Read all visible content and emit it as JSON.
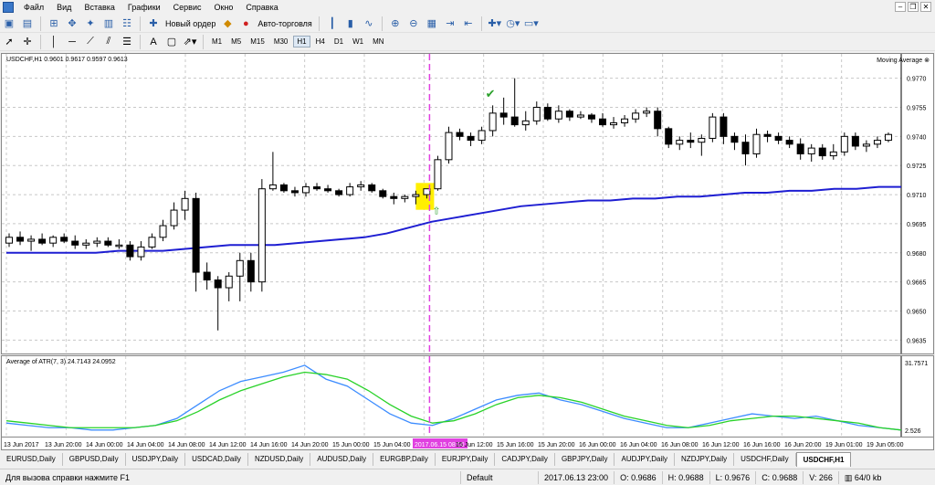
{
  "menu": [
    "Файл",
    "Вид",
    "Вставка",
    "Графики",
    "Сервис",
    "Окно",
    "Справка"
  ],
  "toolbar": {
    "new_order": "Новый ордер",
    "auto_trading": "Авто-торговля",
    "timeframes": [
      "M1",
      "M5",
      "M15",
      "M30",
      "H1",
      "H4",
      "D1",
      "W1",
      "MN"
    ],
    "active_timeframe": "H1",
    "line_text_tool": "A"
  },
  "chart": {
    "symbol_label": "USDCHF,H1  0.9601 0.9617 0.9597 0.9613",
    "indicator_label": "Moving Average",
    "price_ticks": [
      "0.9770",
      "0.9755",
      "0.9740",
      "0.9725",
      "0.9710",
      "0.9695",
      "0.9680",
      "0.9665",
      "0.9650",
      "0.9635"
    ],
    "sub_label": "Average of ATR(7, 3) 24.7143 24.0952",
    "sub_ticks": [
      "31.7571",
      "2.526"
    ],
    "time_ticks": [
      "13 Jun 2017",
      "13 Jun 20:00",
      "14 Jun 00:00",
      "14 Jun 04:00",
      "14 Jun 08:00",
      "14 Jun 12:00",
      "14 Jun 16:00",
      "14 Jun 20:00",
      "15 Jun 00:00",
      "15 Jun 04:00",
      "2017.06.15 08:00",
      "15 Jun 12:00",
      "15 Jun 16:00",
      "15 Jun 20:00",
      "16 Jun 00:00",
      "16 Jun 04:00",
      "16 Jun 08:00",
      "16 Jun 12:00",
      "16 Jun 16:00",
      "16 Jun 20:00",
      "19 Jun 01:00",
      "19 Jun 05:00"
    ],
    "highlight_time": "2017.06.15 08:00",
    "colors": {
      "ma": "#1e1ed2",
      "atr_fast": "#3c8cff",
      "atr_slow": "#28d228",
      "cursor": "#e040e0",
      "highlight": "#ffef00",
      "signal": "#2aa02a"
    }
  },
  "chart_data": {
    "type": "candlestick",
    "candles": [
      [
        0.9685,
        0.969,
        0.9683,
        0.9688
      ],
      [
        0.9688,
        0.9691,
        0.9684,
        0.9686
      ],
      [
        0.9686,
        0.9689,
        0.9681,
        0.9687
      ],
      [
        0.9687,
        0.969,
        0.9684,
        0.9685
      ],
      [
        0.9685,
        0.9689,
        0.9683,
        0.9688
      ],
      [
        0.9688,
        0.969,
        0.9685,
        0.9686
      ],
      [
        0.9686,
        0.9689,
        0.9682,
        0.9684
      ],
      [
        0.9684,
        0.9687,
        0.9682,
        0.9685
      ],
      [
        0.9685,
        0.9688,
        0.9683,
        0.9686
      ],
      [
        0.9686,
        0.9688,
        0.9683,
        0.9684
      ],
      [
        0.9684,
        0.9687,
        0.9682,
        0.9684
      ],
      [
        0.9684,
        0.9686,
        0.9676,
        0.9678
      ],
      [
        0.9678,
        0.9686,
        0.9676,
        0.9683
      ],
      [
        0.9683,
        0.969,
        0.9682,
        0.9688
      ],
      [
        0.9688,
        0.9697,
        0.9686,
        0.9694
      ],
      [
        0.9694,
        0.9706,
        0.9692,
        0.9702
      ],
      [
        0.9702,
        0.9712,
        0.9697,
        0.9708
      ],
      [
        0.9708,
        0.9711,
        0.966,
        0.967
      ],
      [
        0.967,
        0.9675,
        0.9661,
        0.9666
      ],
      [
        0.9666,
        0.9668,
        0.964,
        0.9662
      ],
      [
        0.9662,
        0.967,
        0.9655,
        0.9668
      ],
      [
        0.9668,
        0.968,
        0.9655,
        0.9676
      ],
      [
        0.9676,
        0.968,
        0.966,
        0.9665
      ],
      [
        0.9665,
        0.9718,
        0.966,
        0.9713
      ],
      [
        0.9713,
        0.9732,
        0.9712,
        0.9715
      ],
      [
        0.9715,
        0.9716,
        0.9711,
        0.9712
      ],
      [
        0.9712,
        0.9714,
        0.9709,
        0.9711
      ],
      [
        0.9711,
        0.9716,
        0.9709,
        0.9714
      ],
      [
        0.9714,
        0.9716,
        0.9712,
        0.9713
      ],
      [
        0.9713,
        0.9715,
        0.9711,
        0.9712
      ],
      [
        0.9712,
        0.9713,
        0.9709,
        0.971
      ],
      [
        0.971,
        0.9716,
        0.9709,
        0.9714
      ],
      [
        0.9714,
        0.9717,
        0.9712,
        0.9715
      ],
      [
        0.9715,
        0.9716,
        0.9711,
        0.9712
      ],
      [
        0.9712,
        0.9713,
        0.9708,
        0.9709
      ],
      [
        0.9709,
        0.9711,
        0.9705,
        0.9708
      ],
      [
        0.9708,
        0.971,
        0.9706,
        0.9709
      ],
      [
        0.9709,
        0.9712,
        0.9705,
        0.971
      ],
      [
        0.971,
        0.9713,
        0.9708,
        0.9713
      ],
      [
        0.9713,
        0.973,
        0.9712,
        0.9728
      ],
      [
        0.9728,
        0.9745,
        0.9726,
        0.9742
      ],
      [
        0.9742,
        0.9744,
        0.9738,
        0.974
      ],
      [
        0.974,
        0.9742,
        0.9735,
        0.9738
      ],
      [
        0.9738,
        0.9745,
        0.9736,
        0.9743
      ],
      [
        0.9743,
        0.9756,
        0.974,
        0.9752
      ],
      [
        0.9752,
        0.976,
        0.9746,
        0.975
      ],
      [
        0.975,
        0.977,
        0.9745,
        0.9746
      ],
      [
        0.9746,
        0.9753,
        0.9743,
        0.9748
      ],
      [
        0.9748,
        0.9758,
        0.9746,
        0.9755
      ],
      [
        0.9755,
        0.9757,
        0.9748,
        0.9749
      ],
      [
        0.9749,
        0.9756,
        0.9747,
        0.9753
      ],
      [
        0.9753,
        0.9754,
        0.9748,
        0.975
      ],
      [
        0.975,
        0.9753,
        0.9749,
        0.9751
      ],
      [
        0.9751,
        0.9752,
        0.9747,
        0.9749
      ],
      [
        0.9749,
        0.9752,
        0.9745,
        0.9746
      ],
      [
        0.9746,
        0.975,
        0.9744,
        0.9747
      ],
      [
        0.9747,
        0.9751,
        0.9745,
        0.9749
      ],
      [
        0.9749,
        0.9754,
        0.9747,
        0.9752
      ],
      [
        0.9752,
        0.9755,
        0.975,
        0.9753
      ],
      [
        0.9753,
        0.9755,
        0.974,
        0.9744
      ],
      [
        0.9744,
        0.9745,
        0.9734,
        0.9736
      ],
      [
        0.9736,
        0.974,
        0.9733,
        0.9738
      ],
      [
        0.9738,
        0.9742,
        0.9734,
        0.9737
      ],
      [
        0.9737,
        0.9741,
        0.973,
        0.9739
      ],
      [
        0.9739,
        0.9752,
        0.9737,
        0.975
      ],
      [
        0.975,
        0.9752,
        0.9736,
        0.974
      ],
      [
        0.974,
        0.9742,
        0.9733,
        0.9737
      ],
      [
        0.9737,
        0.9741,
        0.9725,
        0.9731
      ],
      [
        0.9731,
        0.9744,
        0.9729,
        0.9741
      ],
      [
        0.9741,
        0.9743,
        0.9737,
        0.974
      ],
      [
        0.974,
        0.9742,
        0.9736,
        0.9738
      ],
      [
        0.9738,
        0.974,
        0.9734,
        0.9736
      ],
      [
        0.9736,
        0.9739,
        0.9728,
        0.9731
      ],
      [
        0.9731,
        0.9736,
        0.9727,
        0.9734
      ],
      [
        0.9734,
        0.9736,
        0.9728,
        0.973
      ],
      [
        0.973,
        0.9736,
        0.9728,
        0.9732
      ],
      [
        0.9732,
        0.9742,
        0.973,
        0.974
      ],
      [
        0.974,
        0.9742,
        0.9733,
        0.9735
      ],
      [
        0.9735,
        0.9738,
        0.9732,
        0.9736
      ],
      [
        0.9736,
        0.974,
        0.9734,
        0.9738
      ],
      [
        0.9738,
        0.9742,
        0.9737,
        0.9741
      ]
    ],
    "ma": [
      0.968,
      0.968,
      0.968,
      0.968,
      0.968,
      0.9681,
      0.9681,
      0.9681,
      0.9682,
      0.9683,
      0.9684,
      0.9684,
      0.9684,
      0.9685,
      0.9686,
      0.9687,
      0.9688,
      0.969,
      0.9693,
      0.9696,
      0.9698,
      0.97,
      0.9702,
      0.9704,
      0.9705,
      0.9706,
      0.9707,
      0.9707,
      0.9708,
      0.9708,
      0.9709,
      0.9709,
      0.971,
      0.9711,
      0.9711,
      0.9712,
      0.9712,
      0.9713,
      0.9713,
      0.9714,
      0.9714
    ],
    "atr_fast": [
      6,
      5,
      4,
      4,
      3,
      3,
      4,
      5,
      8,
      14,
      20,
      24,
      26,
      28,
      31,
      25,
      22,
      16,
      10,
      6,
      5,
      8,
      12,
      16,
      18,
      19,
      16,
      14,
      11,
      8,
      6,
      4,
      4,
      6,
      8,
      10,
      9,
      8,
      9,
      7,
      5,
      4,
      3
    ],
    "atr_slow": [
      7,
      6,
      5,
      4,
      4,
      4,
      4,
      5,
      7,
      11,
      16,
      20,
      23,
      26,
      28,
      27,
      25,
      20,
      14,
      9,
      6,
      7,
      10,
      14,
      17,
      18,
      17,
      15,
      12,
      9,
      7,
      5,
      4,
      5,
      7,
      8,
      9,
      9,
      8,
      7,
      6,
      4,
      3
    ],
    "price_range": [
      0.963,
      0.9775
    ],
    "sub_range": [
      2.526,
      31.7571
    ]
  }
}
